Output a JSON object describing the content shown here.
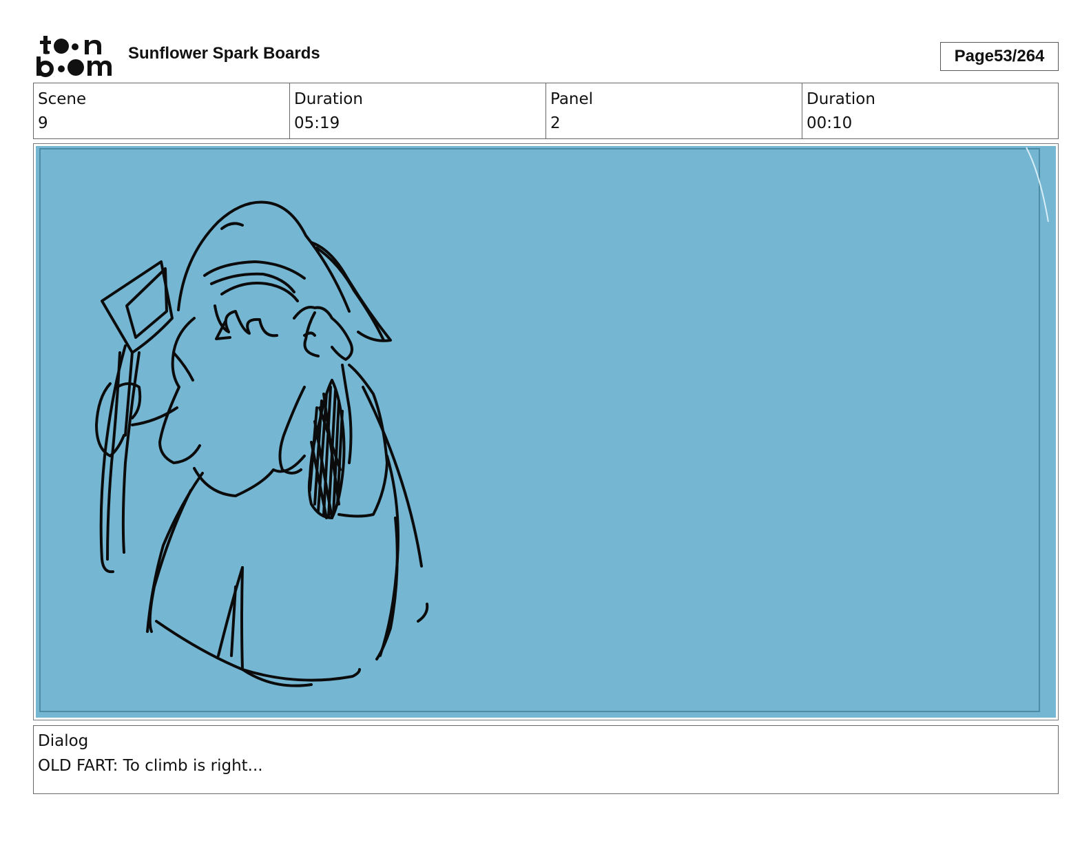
{
  "header": {
    "project_title": "Sunflower Spark Boards",
    "page_label": "Page",
    "page_number": "53/264"
  },
  "info": {
    "scene_label": "Scene",
    "scene_value": "9",
    "scene_duration_label": "Duration",
    "scene_duration_value": "05:19",
    "panel_label": "Panel",
    "panel_value": "2",
    "panel_duration_label": "Duration",
    "panel_duration_value": "00:10"
  },
  "panel": {
    "background_color": "#75b6d2"
  },
  "dialog": {
    "label": "Dialog",
    "text": "OLD FART: To climb is right..."
  },
  "icons": {
    "logo": "toon-boom-logo"
  }
}
